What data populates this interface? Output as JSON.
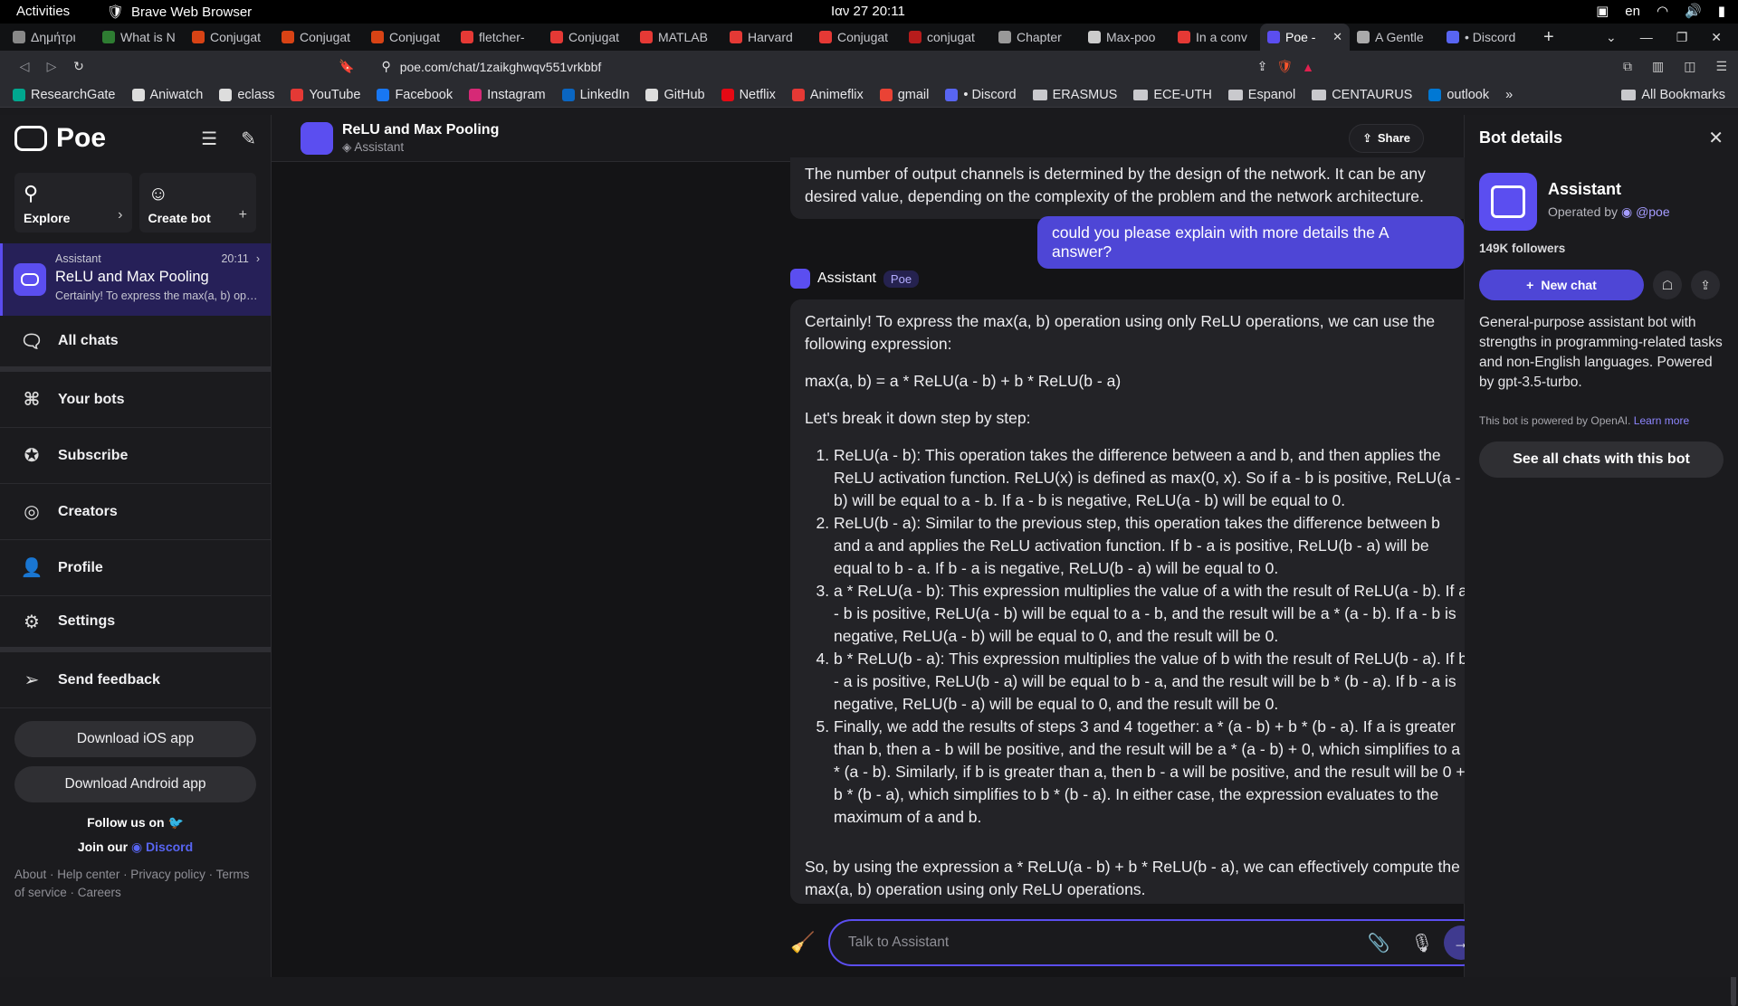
{
  "system": {
    "activities": "Activities",
    "app_name": "Brave Web Browser",
    "clock": "Ιαν 27  20:11",
    "lang": "en"
  },
  "tabs": [
    {
      "label": "Δημήτρι",
      "color": "#888"
    },
    {
      "label": "What is N",
      "color": "#2e7d32"
    },
    {
      "label": "Conjugat",
      "color": "#d84315"
    },
    {
      "label": "Conjugat",
      "color": "#d84315"
    },
    {
      "label": "Conjugat",
      "color": "#d84315"
    },
    {
      "label": "fletcher-",
      "color": "#e53935"
    },
    {
      "label": "Conjugat",
      "color": "#e53935"
    },
    {
      "label": "MATLAB",
      "color": "#e53935"
    },
    {
      "label": "Harvard",
      "color": "#e53935"
    },
    {
      "label": "Conjugat",
      "color": "#e53935"
    },
    {
      "label": "conjugat",
      "color": "#b71c1c"
    },
    {
      "label": "Chapter",
      "color": "#999"
    },
    {
      "label": "Max-poo",
      "color": "#ccc"
    },
    {
      "label": "In a conv",
      "color": "#e53935"
    },
    {
      "label": "Poe -",
      "color": "#5b4ef0",
      "active": true
    },
    {
      "label": "A Gentle",
      "color": "#aaa"
    },
    {
      "label": "• Discord",
      "color": "#5865f2"
    }
  ],
  "address": {
    "url": "poe.com/chat/1zaikghwqv551vrkbbf"
  },
  "bookmarks": [
    {
      "label": "ResearchGate",
      "color": "#00a88f"
    },
    {
      "label": "Aniwatch",
      "color": "#ddd"
    },
    {
      "label": "eclass",
      "color": "#ddd"
    },
    {
      "label": "YouTube",
      "color": "#e53935"
    },
    {
      "label": "Facebook",
      "color": "#1877f2"
    },
    {
      "label": "Instagram",
      "color": "#d62976"
    },
    {
      "label": "LinkedIn",
      "color": "#0a66c2"
    },
    {
      "label": "GitHub",
      "color": "#ddd"
    },
    {
      "label": "Netflix",
      "color": "#e50914"
    },
    {
      "label": "Animeflix",
      "color": "#e53935"
    },
    {
      "label": "gmail",
      "color": "#ea4335"
    },
    {
      "label": "• Discord",
      "color": "#5865f2"
    },
    {
      "label": "ERASMUS",
      "folder": true
    },
    {
      "label": "ECE-UTH",
      "folder": true
    },
    {
      "label": "Espanol",
      "folder": true
    },
    {
      "label": "CENTAURUS",
      "folder": true
    },
    {
      "label": "outlook",
      "color": "#0078d4"
    }
  ],
  "bookmarks_more": "»",
  "bookmarks_all": "All Bookmarks",
  "sidebar": {
    "brand": "Poe",
    "explore": "Explore",
    "create_bot": "Create bot",
    "chat_card": {
      "bot": "Assistant",
      "time": "20:11",
      "title": "ReLU and Max Pooling",
      "preview": "Certainly! To express the max(a, b) ope..."
    },
    "items": [
      {
        "label": "All chats",
        "icon": "chats-icon",
        "glyph": "🗨"
      },
      {
        "label": "Your bots",
        "icon": "bots-icon",
        "glyph": "⌘"
      },
      {
        "label": "Subscribe",
        "icon": "subscribe-icon",
        "glyph": "✪"
      },
      {
        "label": "Creators",
        "icon": "creators-icon",
        "glyph": "◎"
      },
      {
        "label": "Profile",
        "icon": "profile-icon",
        "glyph": "👤"
      },
      {
        "label": "Settings",
        "icon": "settings-icon",
        "glyph": "⚙"
      },
      {
        "label": "Send feedback",
        "icon": "send-icon",
        "glyph": "➢"
      }
    ],
    "download_ios": "Download iOS app",
    "download_android": "Download Android app",
    "follow_us": "Follow us on",
    "join_our": "Join our",
    "discord": "Discord",
    "footer": "About · Help center · Privacy policy · Terms of service · Careers"
  },
  "chat": {
    "title": "ReLU and Max Pooling",
    "subtitle": "Assistant",
    "share": "Share",
    "prev_msg": "The number of output channels is determined by the design of the network. It can be any desired value, depending on the complexity of the problem and the network architecture.",
    "user_msg": "could you please explain with more details the A answer?",
    "bot_name": "Assistant",
    "bot_tag": "Poe",
    "answer": {
      "intro": "Certainly! To express the max(a, b) operation using only ReLU operations, we can use the following expression:",
      "formula": "max(a, b) = a * ReLU(a - b) + b * ReLU(b - a)",
      "lead": "Let's break it down step by step:",
      "steps": [
        "ReLU(a - b): This operation takes the difference between a and b, and then applies the ReLU activation function. ReLU(x) is defined as max(0, x). So if a - b is positive, ReLU(a - b) will be equal to a - b. If a - b is negative, ReLU(a - b) will be equal to 0.",
        "ReLU(b - a): Similar to the previous step, this operation takes the difference between b and a and applies the ReLU activation function. If b - a is positive, ReLU(b - a) will be equal to b - a. If b - a is negative, ReLU(b - a) will be equal to 0.",
        "a * ReLU(a - b): This expression multiplies the value of a with the result of ReLU(a - b). If a - b is positive, ReLU(a - b) will be equal to a - b, and the result will be a * (a - b). If a - b is negative, ReLU(a - b) will be equal to 0, and the result will be 0.",
        "b * ReLU(b - a): This expression multiplies the value of b with the result of ReLU(b - a). If b - a is positive, ReLU(b - a) will be equal to b - a, and the result will be b * (b - a). If b - a is negative, ReLU(b - a) will be equal to 0, and the result will be 0.",
        "Finally, we add the results of steps 3 and 4 together: a * (a - b) + b * (b - a). If a is greater than b, then a - b will be positive, and the result will be a * (a - b) + 0, which simplifies to a * (a - b). Similarly, if b is greater than a, then b - a will be positive, and the result will be 0 + b * (b - a), which simplifies to b * (b - a). In either case, the expression evaluates to the maximum of a and b."
      ],
      "conclusion": "So, by using the expression a * ReLU(a - b) + b * ReLU(b - a), we can effectively compute the max(a, b) operation using only ReLU operations."
    },
    "composer_placeholder": "Talk to Assistant"
  },
  "details": {
    "title": "Bot details",
    "bot_name": "Assistant",
    "operated_by": "Operated by",
    "operator": "@poe",
    "followers": "149K followers",
    "new_chat": "New chat",
    "description": "General-purpose assistant bot with strengths in programming-related tasks and non-English languages. Powered by gpt-3.5-turbo.",
    "powered": "This bot is powered by OpenAI.",
    "learn_more": "Learn more",
    "see_all": "See all chats with this bot"
  },
  "colors": {
    "accent": "#5b4ef0",
    "user_bubble": "#4e46d6"
  }
}
